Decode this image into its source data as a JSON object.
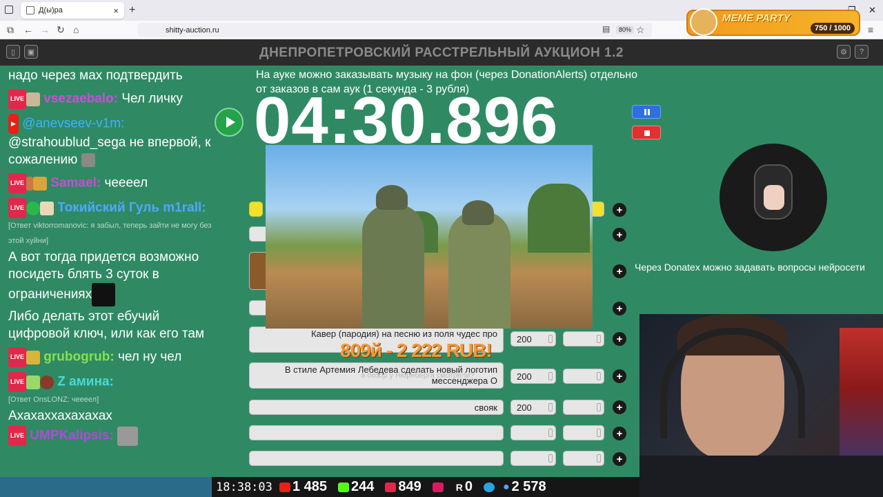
{
  "browser": {
    "tab_title": "Д(ы)ра",
    "url": "shitty-auction.ru",
    "zoom": "80%"
  },
  "meme_party": {
    "title": "MEME PARTY",
    "count": "750 / 1000"
  },
  "app": {
    "title": "ДНЕПРОПЕТРОВСКИЙ РАССТРЕЛЬНЫЙ АУКЦИОН 1.2"
  },
  "chat": {
    "line0": "надо через мах подтвердить",
    "m1": {
      "nick": "vsezaebalo:",
      "text": "Чел личку"
    },
    "m2": {
      "nick": "@anevseev-v1m:",
      "text": "@strahoublud_sega не впервой, к сожалению"
    },
    "m3": {
      "nick": "Samael:",
      "text": "чееeел"
    },
    "m4": {
      "nick": "Токийский Гуль m1rall:",
      "reply": "[Ответ viktorromanovic: я забыл, теперь зайти не могу без этой хуйни]",
      "text": "А вот тогда придется возможно посидеть блять 3 суток в ограничениях"
    },
    "m5": {
      "text": " Либо делать этот ебучий цифровой ключ, или как его там"
    },
    "m6": {
      "nick": "grubogrub:",
      "text": "чел ну чел"
    },
    "m7": {
      "nick": "Z амина:",
      "reply": "[Ответ OnsLONZ: чееeел]",
      "text": "Ахахаххахахахах"
    },
    "m8": {
      "nick": "UMPKalipsis:"
    }
  },
  "notice": "На ауке можно заказывать музыку на фон (через DonationAlerts) отдельно от заказов в сам аук (1 секунда - 3 рубля)",
  "timer": "04:30.896",
  "lots": [
    {
      "name": "Кавер (пародия) на песню из поля чудес про",
      "amount": "200"
    },
    {
      "name": "В стиле Артемия Лебедева сделать новый логотип мессенджера О",
      "amount": "200"
    },
    {
      "name": "свояк",
      "amount": "200"
    }
  ],
  "donation": {
    "headline": "809й - 2 222 RUB!",
    "sub": "а обзор у Нюрнберга смотрели?"
  },
  "donatex_text": "Через Donatex можно задавать вопросы нейросети",
  "stats": {
    "time": "18:38:03",
    "youtube": "1 485",
    "kick": "244",
    "live": "849",
    "r": "0",
    "viewers": "2 578"
  },
  "colors": {
    "page_bg": "#2f8a64",
    "header_bg": "#2b2b2b",
    "accent_orange": "#f29a3a"
  }
}
